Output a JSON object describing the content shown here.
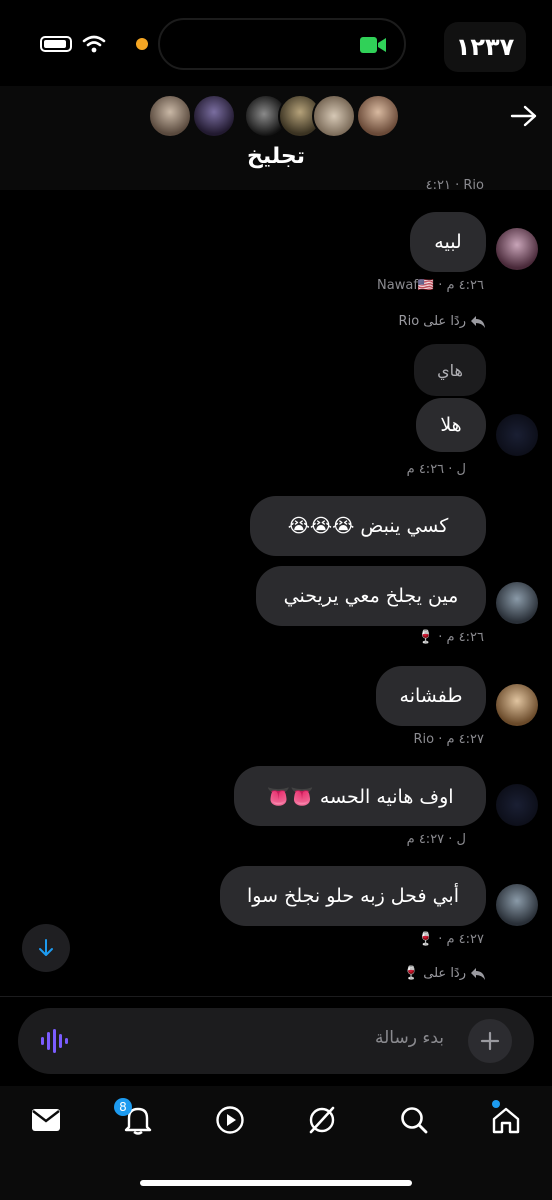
{
  "status_bar": {
    "time": "١٢٣٧"
  },
  "header": {
    "title": "تجليخ",
    "participants": [
      "avatar-1",
      "avatar-2",
      "avatar-3",
      "avatar-4",
      "avatar-5",
      "avatar-6"
    ]
  },
  "messages": {
    "top_meta": "٤:٢١ · Rio",
    "m1": {
      "text": "لبيه",
      "meta": "Nawaf🇺🇸 · ٤:٢٦ م"
    },
    "reply1": "ردًا على Rio",
    "m2": {
      "quoted": "هاي",
      "text": "هلا",
      "meta": "ل · ٤:٢٦ م"
    },
    "m3": {
      "text": "كسي ينبض 😭😭😭"
    },
    "m4": {
      "text": "مين يجلخ معي يريحني",
      "meta": "🍷 · ٤:٢٦ م"
    },
    "m5": {
      "text": "طفشانه",
      "meta": "Rio · ٤:٢٧ م"
    },
    "m6": {
      "text": "اوف هانيه الحسه 👅👅",
      "meta": "ل · ٤:٢٧ م"
    },
    "m7": {
      "text": "أبي فحل زبه حلو نجلخ سوا",
      "meta": "🍷 · ٤:٢٧ م"
    },
    "reply2": "ردًا على 🍷"
  },
  "composer": {
    "placeholder": "بدء رسالة"
  },
  "nav": {
    "notifications_badge": "8"
  },
  "colors": {
    "accent": "#1d9bf0",
    "bubble": "#2b2b2e",
    "voice": "#7b5cff"
  }
}
